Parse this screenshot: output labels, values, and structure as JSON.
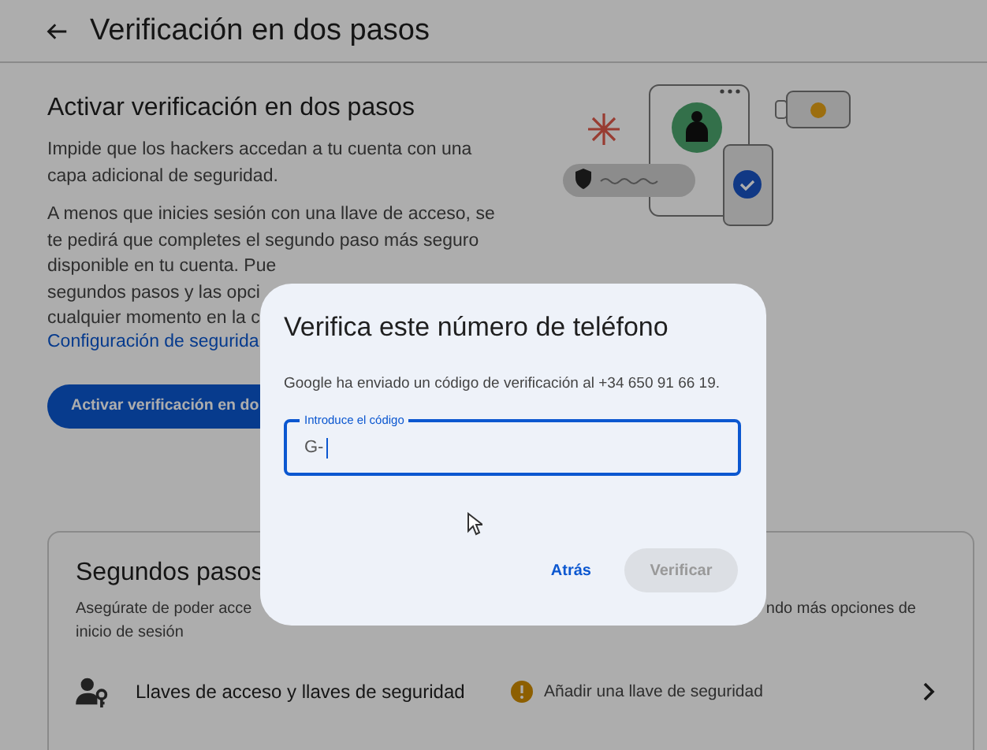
{
  "header": {
    "title": "Verificación en dos pasos"
  },
  "intro": {
    "heading": "Activar verificación en dos pasos",
    "paragraphs": [
      [
        "Impide que los hackers accedan a tu cuenta con una",
        "capa adicional de seguridad."
      ],
      [
        "A menos que inicies sesión con una llave de acceso, se",
        "te pedirá que completes el segundo paso más seguro",
        "disponible en tu cuenta. Pue",
        "segundos pasos y las opci",
        "cualquier momento en la c"
      ]
    ],
    "link": "Configuración de segurida",
    "button": "Activar verificación en do"
  },
  "second_steps": {
    "heading": "Segundos pasos",
    "description": [
      {
        "left": "Asegúrate de poder acce",
        "right": "ndo más opciones de"
      },
      {
        "left": "inicio de sesión"
      }
    ],
    "rows": [
      {
        "label": "Llaves de acceso y llaves de seguridad",
        "status": "Añadir una llave de seguridad"
      }
    ]
  },
  "dialog": {
    "title": "Verifica este número de teléfono",
    "message": "Google ha enviado un código de verificación al +34 650 91 66 19.",
    "field": {
      "label": "Introduce el código",
      "value": "G-",
      "focused": true
    },
    "buttons": [
      {
        "label": "Atrás",
        "kind": "text",
        "disabled": false
      },
      {
        "label": "Verificar",
        "kind": "filled",
        "disabled": true
      }
    ]
  }
}
